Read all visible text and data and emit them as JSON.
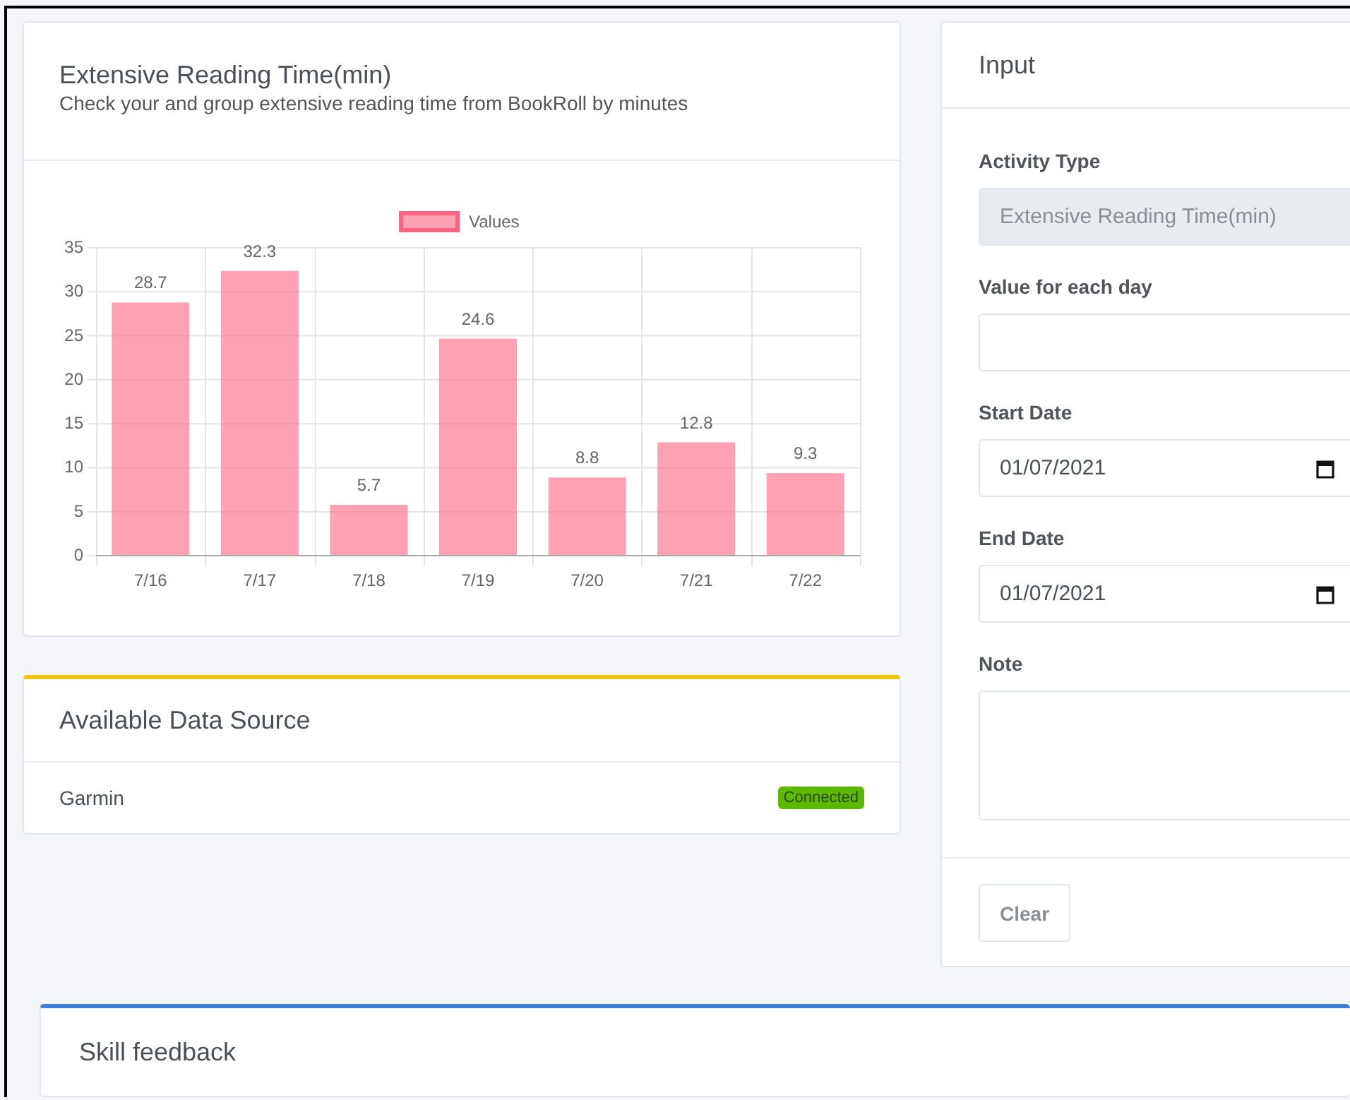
{
  "chart_card": {
    "title": "Extensive Reading Time(min)",
    "subtitle": "Check your and group extensive reading time from BookRoll by minutes",
    "chart_data": {
      "type": "bar",
      "categories": [
        "7/16",
        "7/17",
        "7/18",
        "7/19",
        "7/20",
        "7/21",
        "7/22"
      ],
      "series": [
        {
          "name": "Values",
          "color": "#ff6384",
          "values": [
            28.7,
            32.3,
            5.7,
            24.6,
            8.8,
            12.8,
            9.3
          ]
        }
      ],
      "ylim": [
        0,
        35
      ],
      "yticks": [
        0,
        5,
        10,
        15,
        20,
        25,
        30,
        35
      ],
      "data_labels": true,
      "grid": true
    }
  },
  "data_source": {
    "title": "Available Data Source",
    "items": [
      {
        "name": "Garmin",
        "status": "Connected"
      }
    ]
  },
  "input_panel": {
    "title": "Input",
    "fields": [
      {
        "kind": "text",
        "label": "Activity Type",
        "value": "Extensive Reading Time(min)",
        "disabled": true
      },
      {
        "kind": "text",
        "label": "Value for each day",
        "disabled": false
      },
      {
        "kind": "date",
        "label": "Start Date",
        "value": "01/07/2021"
      },
      {
        "kind": "date",
        "label": "End Date",
        "value": "01/07/2021"
      },
      {
        "kind": "textarea",
        "label": "Note"
      }
    ],
    "buttons": [
      "Clear"
    ]
  },
  "skill_feedback": {
    "title": "Skill feedback"
  }
}
